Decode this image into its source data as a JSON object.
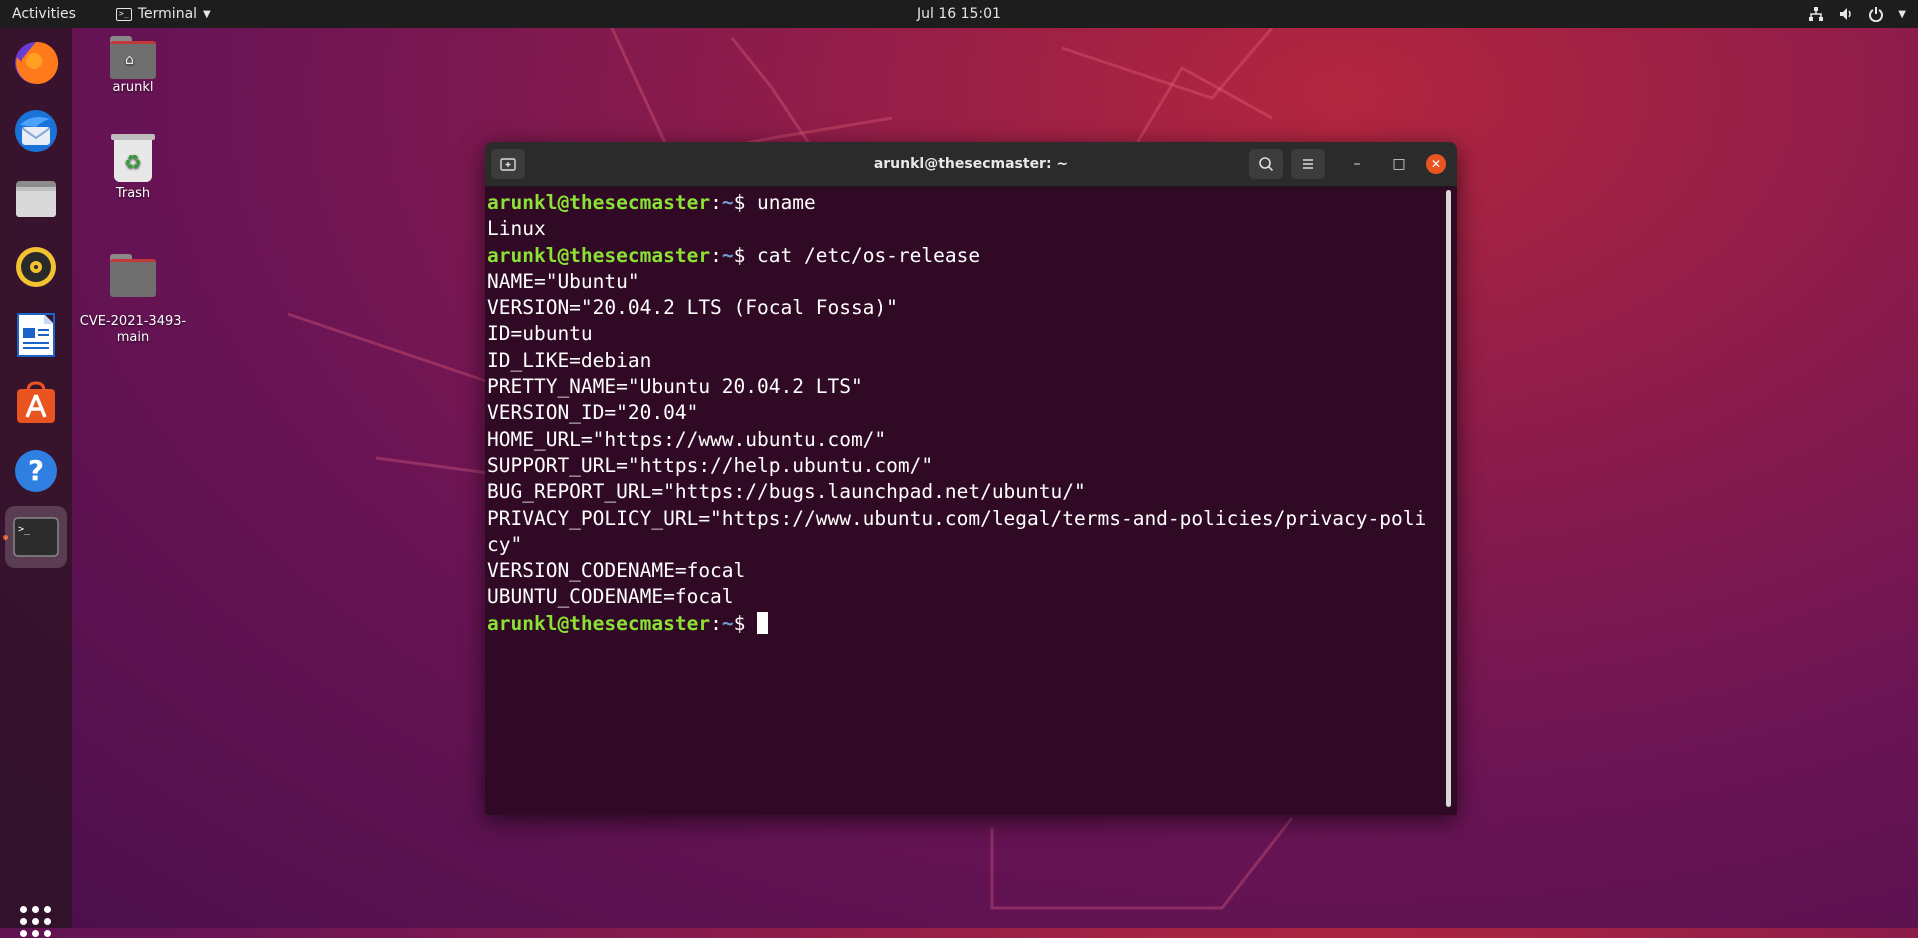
{
  "topbar": {
    "activities": "Activities",
    "app_name": "Terminal",
    "app_menu_icon": "chevron-down-icon",
    "clock": "Jul 16  15:01",
    "status_icons": [
      "network-icon",
      "volume-icon",
      "power-icon",
      "chevron-down-icon"
    ]
  },
  "dock": {
    "items": [
      {
        "name": "Firefox",
        "icon": "firefox-icon"
      },
      {
        "name": "Thunderbird",
        "icon": "thunderbird-icon"
      },
      {
        "name": "Files",
        "icon": "files-icon"
      },
      {
        "name": "Rhythmbox",
        "icon": "rhythmbox-icon"
      },
      {
        "name": "LibreOffice Writer",
        "icon": "writer-icon"
      },
      {
        "name": "Ubuntu Software",
        "icon": "software-icon"
      },
      {
        "name": "Help",
        "icon": "help-icon"
      },
      {
        "name": "Terminal",
        "icon": "terminal-icon",
        "active": true
      }
    ],
    "show_apps_icon": "grid-icon"
  },
  "desktop": {
    "icons": [
      {
        "label": "arunkl",
        "icon": "home-folder-icon"
      },
      {
        "label": "Trash",
        "icon": "trash-icon"
      },
      {
        "label": "CVE-2021-3493-\nmain",
        "icon": "folder-icon"
      }
    ]
  },
  "terminal": {
    "title": "arunkl@thesecmaster: ~",
    "user_host": "arunkl@thesecmaster",
    "path": "~",
    "lines": [
      {
        "type": "prompt",
        "command": "uname"
      },
      {
        "type": "output",
        "text": "Linux"
      },
      {
        "type": "prompt",
        "command": "cat /etc/os-release"
      },
      {
        "type": "output",
        "text": "NAME=\"Ubuntu\""
      },
      {
        "type": "output",
        "text": "VERSION=\"20.04.2 LTS (Focal Fossa)\""
      },
      {
        "type": "output",
        "text": "ID=ubuntu"
      },
      {
        "type": "output",
        "text": "ID_LIKE=debian"
      },
      {
        "type": "output",
        "text": "PRETTY_NAME=\"Ubuntu 20.04.2 LTS\""
      },
      {
        "type": "output",
        "text": "VERSION_ID=\"20.04\""
      },
      {
        "type": "output",
        "text": "HOME_URL=\"https://www.ubuntu.com/\""
      },
      {
        "type": "output",
        "text": "SUPPORT_URL=\"https://help.ubuntu.com/\""
      },
      {
        "type": "output",
        "text": "BUG_REPORT_URL=\"https://bugs.launchpad.net/ubuntu/\""
      },
      {
        "type": "output",
        "text": "PRIVACY_POLICY_URL=\"https://www.ubuntu.com/legal/terms-and-policies/privacy-poli"
      },
      {
        "type": "output",
        "text": "cy\""
      },
      {
        "type": "output",
        "text": "VERSION_CODENAME=focal"
      },
      {
        "type": "output",
        "text": "UBUNTU_CODENAME=focal"
      },
      {
        "type": "prompt",
        "command": "",
        "cursor": true
      }
    ]
  },
  "colors": {
    "prompt_user": "#8ae234",
    "prompt_path": "#729fcf",
    "terminal_bg": "#300a24",
    "close_button": "#e95420"
  }
}
